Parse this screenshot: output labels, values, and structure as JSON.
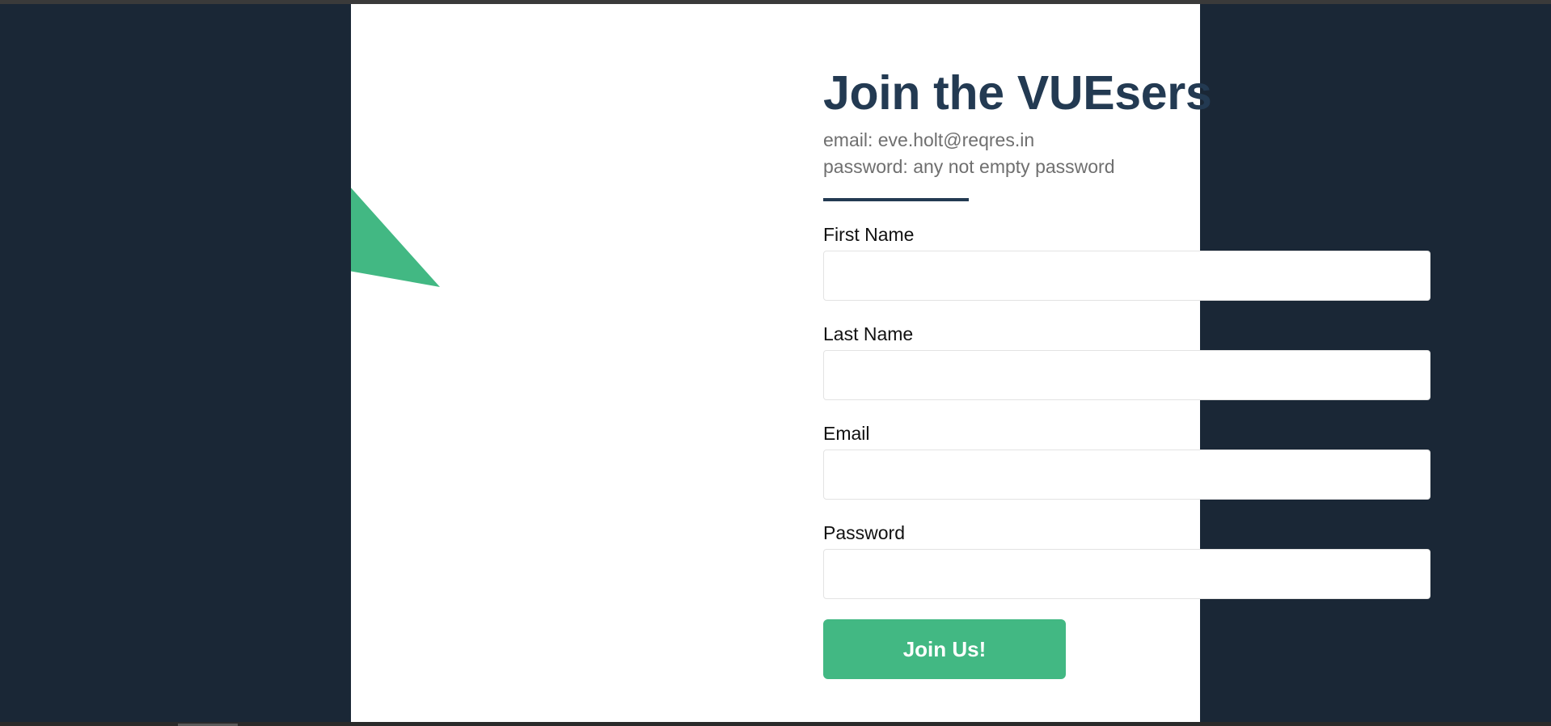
{
  "colors": {
    "background": "#1a2736",
    "card": "#ffffff",
    "title": "#233a52",
    "accent": "#42b883",
    "logo_dark": "#35495e"
  },
  "logo": {
    "icon": "vue-logo-icon"
  },
  "header": {
    "title": "Join the VUEsers",
    "hint_email": "email: eve.holt@reqres.in",
    "hint_password": "password: any not empty password"
  },
  "form": {
    "fields": [
      {
        "label": "First Name",
        "value": "",
        "placeholder": ""
      },
      {
        "label": "Last Name",
        "value": "",
        "placeholder": ""
      },
      {
        "label": "Email",
        "value": "",
        "placeholder": ""
      },
      {
        "label": "Password",
        "value": "",
        "placeholder": ""
      }
    ],
    "submit_label": "Join Us!"
  }
}
